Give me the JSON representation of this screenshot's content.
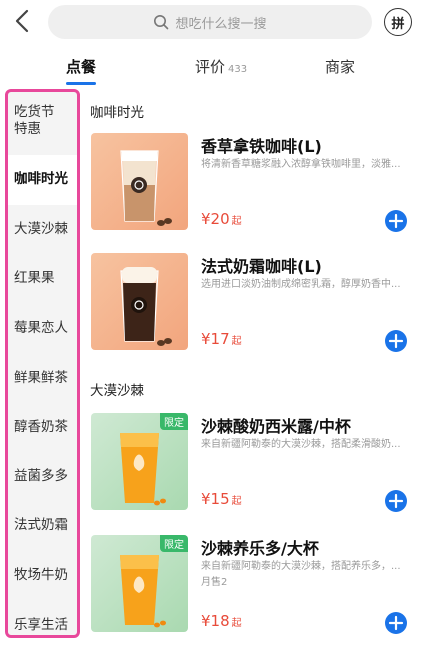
{
  "header": {
    "search_placeholder": "想吃什么搜一搜",
    "pin_label": "拼"
  },
  "tabs": [
    {
      "label": "点餐",
      "active": true
    },
    {
      "label": "评价",
      "count": "433"
    },
    {
      "label": "商家"
    }
  ],
  "sidebar": {
    "items": [
      {
        "label": "吃货节\n特惠"
      },
      {
        "label": "咖啡时光",
        "active": true
      },
      {
        "label": "大漠沙棘"
      },
      {
        "label": "红果果"
      },
      {
        "label": "莓果恋人"
      },
      {
        "label": "鲜果鲜茶"
      },
      {
        "label": "醇香奶茶"
      },
      {
        "label": "益菌多多"
      },
      {
        "label": "法式奶霜"
      },
      {
        "label": "牧场牛奶"
      },
      {
        "label": "乐享生活"
      }
    ]
  },
  "sections": [
    {
      "title": "咖啡时光",
      "products": [
        {
          "name": "香草拿铁咖啡(L)",
          "desc": "将清新香草糖浆融入浓醇拿铁咖啡里，淡雅...",
          "price": "¥20",
          "price_suffix": "起"
        },
        {
          "name": "法式奶霜咖啡(L)",
          "desc": "选用进口淡奶油制成绵密乳霜，醇厚奶香中...",
          "price": "¥17",
          "price_suffix": "起"
        }
      ]
    },
    {
      "title": "大漠沙棘",
      "products": [
        {
          "name": "沙棘酸奶西米露/中杯",
          "desc": "来自新疆阿勒泰的大漠沙棘，搭配柔滑酸奶...",
          "price": "¥15",
          "price_suffix": "起",
          "badge": "限定"
        },
        {
          "name": "沙棘养乐多/大杯",
          "desc": "来自新疆阿勒泰的大漠沙棘，搭配养乐多，...",
          "sales": "月售2",
          "price": "¥18",
          "price_suffix": "起",
          "badge": "限定"
        }
      ]
    }
  ],
  "colors": {
    "accent": "#1a73e8",
    "price": "#e84b3a",
    "highlight_border": "#e8489b",
    "limited_badge": "#39b86a"
  }
}
